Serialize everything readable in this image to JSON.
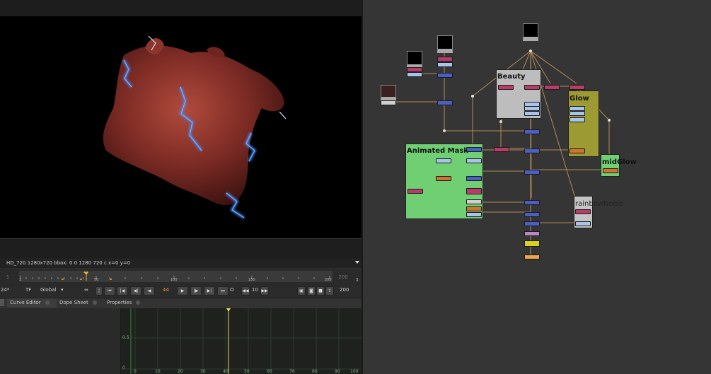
{
  "viewer": {
    "info": "HD_720 1280x720  bbox: 0 0 1280 720 c  x=0 y=0"
  },
  "timeline": {
    "start": "1",
    "end": "200",
    "ticks": [
      "1",
      "50",
      "100",
      "150",
      "200"
    ],
    "current_frame": "44"
  },
  "playbar": {
    "fps": "24*",
    "tf": "TF",
    "scope": "Global",
    "frame": "44",
    "step": "10",
    "end_frame": "200"
  },
  "tabs": [
    {
      "label": "Curve Editor"
    },
    {
      "label": "Dope Sheet"
    },
    {
      "label": "Properties"
    }
  ],
  "curve_editor": {
    "y_ticks": [
      "0.5",
      "0"
    ],
    "x_ticks": [
      "0",
      "10",
      "20",
      "30",
      "40",
      "50",
      "60",
      "70",
      "80",
      "90",
      "100"
    ],
    "playhead_frame": 40
  },
  "node_graph": {
    "backdrops": {
      "beauty": "Beauty",
      "glow": "Glow",
      "animated_mask": "Animated Mask",
      "mid_glow": "midGlow",
      "rainbow_noise": "rainbowNoise"
    },
    "colors": {
      "beauty": "#bdbdbd",
      "glow": "#9c9a32",
      "animated_mask": "#6fcf72",
      "mid_glow": "#6fcf72",
      "rainbow_noise": "#c4c4c4",
      "merge_node": "#4a5fc4",
      "grade_node": "#b83b6a",
      "blur_node": "#d2742e",
      "write_node": "#f0a34a",
      "viewer_node": "#d7d21a"
    }
  }
}
